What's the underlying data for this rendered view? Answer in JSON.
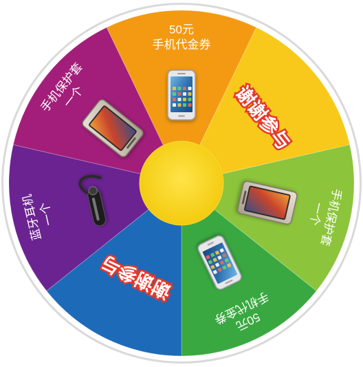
{
  "wheel": {
    "rim_color": "#ffffff",
    "hub_color": "#f5d20e",
    "segments": [
      {
        "id": "coupon-50-top",
        "color": "#f39a12",
        "lines": [
          "50元",
          "手机代金券"
        ],
        "icon": "smartphone-icon",
        "style": "prize"
      },
      {
        "id": "thanks-right",
        "color": "#f8c91a",
        "lines": [
          "谢谢参与"
        ],
        "icon": "",
        "style": "thanks"
      },
      {
        "id": "case-right",
        "color": "#8cc43b",
        "lines": [
          "手机保护套",
          "一个"
        ],
        "icon": "phone-case-icon",
        "style": "prize"
      },
      {
        "id": "coupon-50-bottom",
        "color": "#3aa841",
        "lines": [
          "50元",
          "手机代金券"
        ],
        "icon": "smartphone-icon",
        "style": "prize"
      },
      {
        "id": "thanks-left",
        "color": "#1d6ab8",
        "lines": [
          "谢谢参与"
        ],
        "icon": "",
        "style": "thanks"
      },
      {
        "id": "bluetooth-left",
        "color": "#6b2391",
        "lines": [
          "蓝牙耳机",
          "一个"
        ],
        "icon": "bluetooth-headset-icon",
        "style": "prize"
      },
      {
        "id": "case-topleft",
        "color": "#a21e7a",
        "lines": [
          "手机保护套",
          "一个"
        ],
        "icon": "phone-case-icon",
        "style": "prize"
      }
    ]
  }
}
